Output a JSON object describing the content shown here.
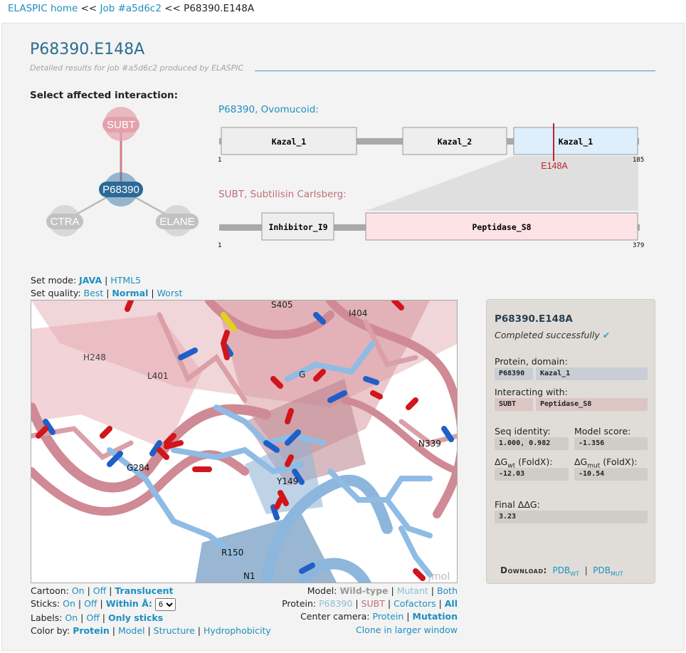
{
  "breadcrumb": {
    "home": "ELASPIC home",
    "sep1": " << ",
    "job": "Job #a5d6c2",
    "sep2": " << ",
    "current": "P68390.E148A"
  },
  "header": {
    "title": "P68390.E148A",
    "subtitle": "Detailed results for job #a5d6c2 produced by ELASPIC"
  },
  "interaction": {
    "heading": "Select affected interaction:",
    "nodes": [
      "SUBT",
      "P68390",
      "CTRA",
      "ELANE"
    ]
  },
  "protein1": {
    "id": "P68390",
    "name": ", Ovomucoid:",
    "domains": [
      "Kazal_1",
      "Kazal_2",
      "Kazal_1"
    ],
    "start": "1",
    "end": "185",
    "mutation": "E148A"
  },
  "protein2": {
    "id": "SUBT",
    "name": ", Subtilisin Carlsberg:",
    "domains": [
      "Inhibitor_I9",
      "Peptidase_S8"
    ],
    "start": "1",
    "end": "379"
  },
  "mode": {
    "label": "Set mode: ",
    "java": "JAVA",
    "sep": " | ",
    "html5": "HTML5"
  },
  "quality": {
    "label": "Set quality: ",
    "best": "Best",
    "normal": "Normal",
    "worst": "Worst"
  },
  "viewer": {
    "labels": [
      "S405",
      "H248",
      "I404",
      "L401",
      "G",
      "G284",
      "Y149",
      "N339",
      "R150",
      "N1"
    ],
    "watermark": "Jmol"
  },
  "controls_left": {
    "cartoon": {
      "label": "Cartoon: ",
      "on": "On",
      "off": "Off",
      "translucent": "Translucent"
    },
    "sticks": {
      "label": "Sticks: ",
      "on": "On",
      "off": "Off",
      "within": "Within Å:",
      "value": "6"
    },
    "labels": {
      "label": "Labels: ",
      "on": "On",
      "off": "Off",
      "only": "Only sticks"
    },
    "color": {
      "label": "Color by: ",
      "protein": "Protein",
      "model": "Model",
      "structure": "Structure",
      "hydro": "Hydrophobicity"
    }
  },
  "controls_right": {
    "model": {
      "label": "Model: ",
      "wt": "Wild-type",
      "mut": "Mutant",
      "both": "Both"
    },
    "protein": {
      "label": "Protein: ",
      "p1": "P68390",
      "p2": "SUBT",
      "cof": "Cofactors",
      "all": "All"
    },
    "camera": {
      "label": "Center camera: ",
      "protein": "Protein",
      "mutation": "Mutation"
    },
    "clone": "Clone in larger window"
  },
  "card": {
    "title": "P68390.E148A",
    "status": "Completed successfully",
    "check": "✔",
    "pd_label": "Protein, domain:",
    "pd_protein": "P68390",
    "pd_domain": "Kazal_1",
    "iw_label": "Interacting with:",
    "iw_protein": "SUBT",
    "iw_domain": "Peptidase_S8",
    "seq_label": "Seq identity:",
    "seq": "1.000, 0.982",
    "ms_label": "Model score:",
    "ms": "-1.356",
    "dgwt_pre": "ΔG",
    "dgwt_sub": "wt",
    "dgwt_post": " (FoldX):",
    "dgwt": "-12.03",
    "dgmut_pre": "ΔG",
    "dgmut_sub": "mut",
    "dgmut_post": " (FoldX):",
    "dgmut": "-10.54",
    "final_label": "Final ΔΔG:",
    "final": "3.23",
    "download": "Download:",
    "pdb": "PDB",
    "wt": "WT",
    "mut": "MUT"
  },
  "colors": {
    "link": "#1d8fbf",
    "title": "#2a6d8f",
    "mutation": "#c0202d",
    "subt": "#d58a96",
    "p68390": "#2b6a97",
    "grey": "#b4b4b4"
  }
}
